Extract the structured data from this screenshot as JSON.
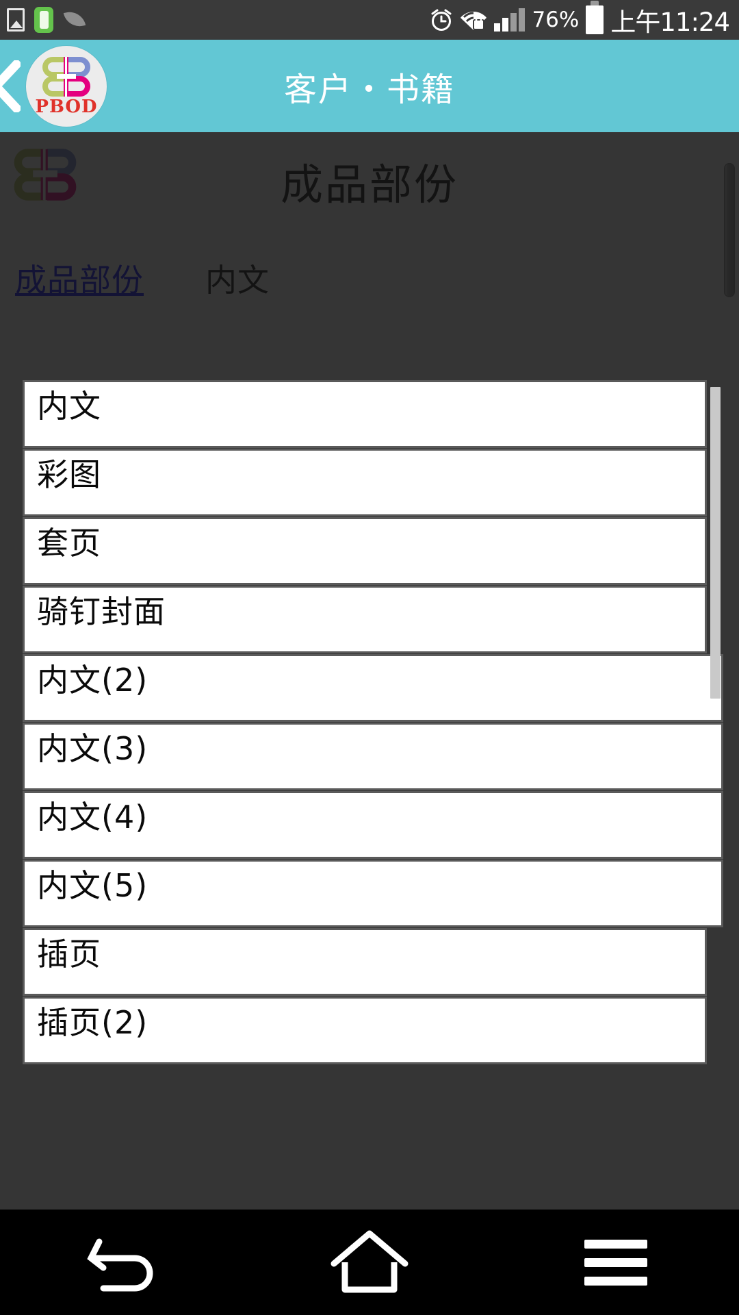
{
  "status_bar": {
    "icons_left": [
      "gallery-icon",
      "battery-saver-icon",
      "leaf-icon"
    ],
    "icons_right": [
      "alarm-icon",
      "wifi-locked-icon",
      "signal-icon"
    ],
    "battery_percent": "76%",
    "time": "上午11:24"
  },
  "app_bar": {
    "back_label": "‹",
    "brand_mark": "pbod-logo-icon",
    "brand_word": "PBOD",
    "title": "客户・书籍"
  },
  "page": {
    "logo": "pbod-b-mark-icon",
    "title": "成品部份",
    "field": {
      "label": "成品部份",
      "value": "内文"
    }
  },
  "dropdown": {
    "name": "成品部份",
    "selected": "内文",
    "options": [
      "内文",
      "彩图",
      "套页",
      "骑钉封面",
      "内文(2)",
      "内文(3)",
      "内文(4)",
      "内文(5)",
      "插页",
      "插页(2)"
    ]
  },
  "nav_bar": {
    "buttons": [
      "back-nav-icon",
      "home-nav-icon",
      "recents-nav-icon"
    ]
  },
  "colors": {
    "app_bar": "#62c7d4",
    "link": "#1414ff",
    "status_bar": "#3a3a3a",
    "nav_bar": "#000000",
    "brand_green": "#b5c койка"
  }
}
